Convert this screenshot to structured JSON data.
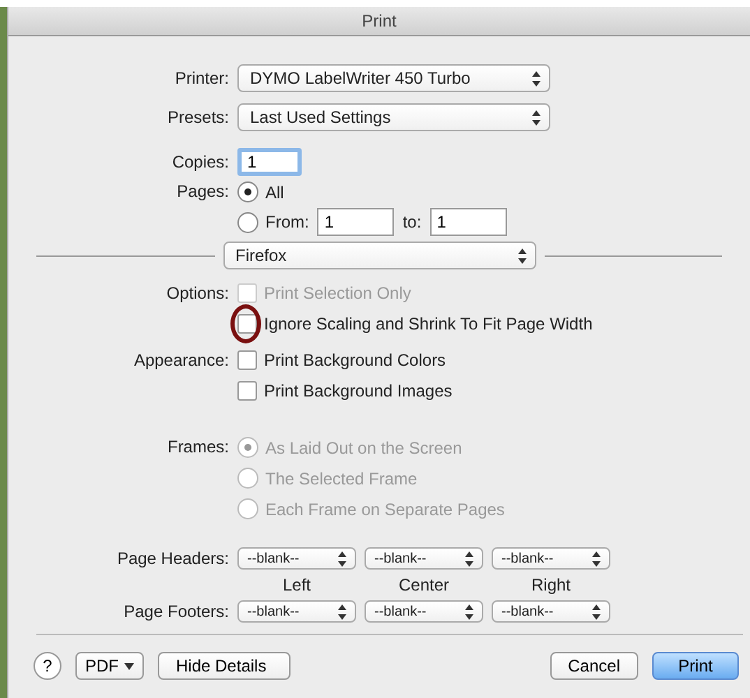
{
  "window": {
    "title": "Print"
  },
  "printer": {
    "label": "Printer:",
    "value": "DYMO LabelWriter 450 Turbo"
  },
  "presets": {
    "label": "Presets:",
    "value": "Last Used Settings"
  },
  "copies": {
    "label": "Copies:",
    "value": "1"
  },
  "pages": {
    "label": "Pages:",
    "options": [
      {
        "label": "All",
        "selected": true
      },
      {
        "label": "From:",
        "selected": false
      }
    ],
    "from": "1",
    "to_label": "to:",
    "to": "1"
  },
  "section_menu": {
    "value": "Firefox"
  },
  "options": {
    "label": "Options:",
    "items": [
      {
        "label": "Print Selection Only",
        "checked": false,
        "disabled": true,
        "highlighted": false
      },
      {
        "label": "Ignore Scaling and Shrink To Fit Page Width",
        "checked": false,
        "disabled": false,
        "highlighted": true
      }
    ]
  },
  "appearance": {
    "label": "Appearance:",
    "items": [
      {
        "label": "Print Background Colors",
        "checked": false,
        "disabled": false,
        "highlighted": false
      },
      {
        "label": "Print Background Images",
        "checked": false,
        "disabled": false,
        "highlighted": false
      }
    ]
  },
  "frames": {
    "label": "Frames:",
    "disabled": true,
    "options": [
      {
        "label": "As Laid Out on the Screen",
        "selected": true
      },
      {
        "label": "The Selected Frame",
        "selected": false
      },
      {
        "label": "Each Frame on Separate Pages",
        "selected": false
      }
    ]
  },
  "headers": {
    "label": "Page Headers:",
    "values": [
      "--blank--",
      "--blank--",
      "--blank--"
    ]
  },
  "columns": [
    "Left",
    "Center",
    "Right"
  ],
  "footers": {
    "label": "Page Footers:",
    "values": [
      "--blank--",
      "--blank--",
      "--blank--"
    ]
  },
  "footer_bar": {
    "help": "?",
    "pdf": "PDF",
    "hide_details": "Hide Details",
    "cancel": "Cancel",
    "print": "Print"
  }
}
